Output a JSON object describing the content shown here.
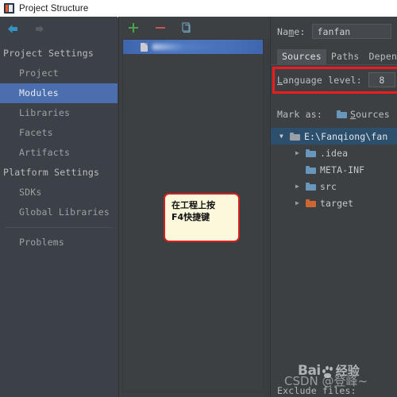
{
  "window": {
    "title": "Project Structure",
    "icon": "intellij-idea-icon"
  },
  "nav": {
    "back_icon": "back-arrow-icon",
    "forward_icon": "forward-arrow-icon"
  },
  "sidebar": {
    "items": [
      {
        "label": "Project Settings",
        "type": "group",
        "selected": false
      },
      {
        "label": "Project",
        "type": "child",
        "selected": false
      },
      {
        "label": "Modules",
        "type": "child",
        "selected": true
      },
      {
        "label": "Libraries",
        "type": "child",
        "selected": false
      },
      {
        "label": "Facets",
        "type": "child",
        "selected": false
      },
      {
        "label": "Artifacts",
        "type": "child",
        "selected": false
      },
      {
        "label": "Platform Settings",
        "type": "group",
        "selected": false
      },
      {
        "label": "SDKs",
        "type": "child",
        "selected": false
      },
      {
        "label": "Global Libraries",
        "type": "child",
        "selected": false
      },
      {
        "label": "Problems",
        "type": "child",
        "selected": false
      }
    ]
  },
  "modules_panel": {
    "toolbar": {
      "add_icon": "plus-icon",
      "remove_icon": "minus-icon",
      "copy_icon": "copy-icon",
      "add_label": "+",
      "remove_label": "−"
    },
    "rows": [
      {
        "icon": "module-file-icon",
        "label": "",
        "selected": true
      }
    ]
  },
  "right_panel": {
    "name_label": "Name:",
    "name_value": "fanfan",
    "name_placeholder": "",
    "tabs": [
      {
        "label": "Sources",
        "active": true
      },
      {
        "label": "Paths",
        "active": false
      },
      {
        "label": "Depende",
        "active": false
      }
    ],
    "language_level_label": "Language level:",
    "language_level_value": "8",
    "highlight_color": "#ee1c1c",
    "mark_as_label": "Mark as:",
    "mark_buttons": [
      {
        "label": "Sources",
        "icon": "folder-blue-icon"
      }
    ],
    "tree": [
      {
        "label": "E:\\Fanqiong\\fan",
        "indent": 0,
        "twisty": "open",
        "icon": "folder-grey-icon",
        "selected": true
      },
      {
        "label": ".idea",
        "indent": 1,
        "twisty": "closed",
        "icon": "folder-blue-icon",
        "selected": false
      },
      {
        "label": "META-INF",
        "indent": 1,
        "twisty": "none",
        "icon": "folder-blue-icon",
        "selected": false
      },
      {
        "label": "src",
        "indent": 1,
        "twisty": "closed",
        "icon": "folder-blue-icon",
        "selected": false
      },
      {
        "label": "target",
        "indent": 1,
        "twisty": "closed",
        "icon": "folder-orange-icon",
        "selected": false
      }
    ],
    "exclude_files_label": "Exclude files:"
  },
  "annotation": {
    "line1": "在工程上按",
    "line2": "F4快捷键",
    "border_color": "#d21f1f",
    "background_color": "#fbf8dc"
  },
  "watermarks": {
    "baidu_text": "Bai",
    "baidu_paw": "paw-icon",
    "baidu_suffix": "经验",
    "csdn": "CSDN @登峰~"
  }
}
